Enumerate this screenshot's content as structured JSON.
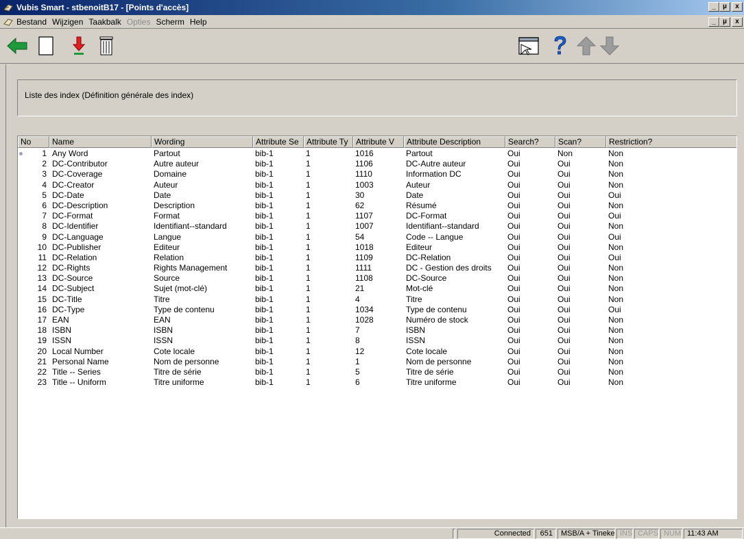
{
  "window": {
    "title": "Vubis Smart - stbenoitB17 - [Points d'accès]",
    "controls": [
      "_",
      "µ",
      "x"
    ]
  },
  "menu": [
    {
      "label": "Bestand",
      "disabled": false
    },
    {
      "label": "Wijzigen",
      "disabled": false
    },
    {
      "label": "Taakbalk",
      "disabled": false
    },
    {
      "label": "Opties",
      "disabled": true
    },
    {
      "label": "Scherm",
      "disabled": false
    },
    {
      "label": "Help",
      "disabled": false
    }
  ],
  "toolbar": {
    "icons": [
      "back-arrow-icon",
      "new-document-icon",
      "download-arrow-icon",
      "trash-icon",
      "window-select-icon",
      "help-question-icon",
      "arrow-up-icon",
      "arrow-down-icon"
    ],
    "colors": {
      "back": "#1e9a3a",
      "down": "#e02020",
      "gray_arrow": "#9c9c9c",
      "help": "#1a5dc8"
    }
  },
  "header": {
    "text": "Liste des index (Définition générale des index)"
  },
  "grid": {
    "columns": [
      "No",
      "Name",
      "Wording",
      "Attribute Se",
      "Attribute Ty",
      "Attribute V",
      "Attribute Description",
      "Search?",
      "Scan?",
      "Restriction?"
    ],
    "rows": [
      [
        "1",
        "Any Word",
        "Partout",
        "bib-1",
        "1",
        "1016",
        "Partout",
        "Oui",
        "Non",
        "Non"
      ],
      [
        "2",
        "DC-Contributor",
        "Autre auteur",
        "bib-1",
        "1",
        "1106",
        "DC-Autre auteur",
        "Oui",
        "Oui",
        "Non"
      ],
      [
        "3",
        "DC-Coverage",
        "Domaine",
        "bib-1",
        "1",
        "1110",
        "Information DC",
        "Oui",
        "Oui",
        "Non"
      ],
      [
        "4",
        "DC-Creator",
        "Auteur",
        "bib-1",
        "1",
        "1003",
        "Auteur",
        "Oui",
        "Oui",
        "Non"
      ],
      [
        "5",
        "DC-Date",
        "Date",
        "bib-1",
        "1",
        "30",
        "Date",
        "Oui",
        "Oui",
        "Oui"
      ],
      [
        "6",
        "DC-Description",
        "Description",
        "bib-1",
        "1",
        "62",
        "Résumé",
        "Oui",
        "Oui",
        "Non"
      ],
      [
        "7",
        "DC-Format",
        "Format",
        "bib-1",
        "1",
        "1107",
        "DC-Format",
        "Oui",
        "Oui",
        "Oui"
      ],
      [
        "8",
        "DC-Identifier",
        "Identifiant--standard",
        "bib-1",
        "1",
        "1007",
        "Identifiant--standard",
        "Oui",
        "Oui",
        "Non"
      ],
      [
        "9",
        "DC-Language",
        "Langue",
        "bib-1",
        "1",
        "54",
        "Code -- Langue",
        "Oui",
        "Oui",
        "Oui"
      ],
      [
        "10",
        "DC-Publisher",
        "Editeur",
        "bib-1",
        "1",
        "1018",
        "Editeur",
        "Oui",
        "Oui",
        "Non"
      ],
      [
        "11",
        "DC-Relation",
        "Relation",
        "bib-1",
        "1",
        "1109",
        "DC-Relation",
        "Oui",
        "Oui",
        "Oui"
      ],
      [
        "12",
        "DC-Rights",
        "Rights Management",
        "bib-1",
        "1",
        "1111",
        "DC - Gestion des droits",
        "Oui",
        "Oui",
        "Non"
      ],
      [
        "13",
        "DC-Source",
        "Source",
        "bib-1",
        "1",
        "1108",
        "DC-Source",
        "Oui",
        "Oui",
        "Non"
      ],
      [
        "14",
        "DC-Subject",
        "Sujet (mot-clé)",
        "bib-1",
        "1",
        "21",
        "Mot-clé",
        "Oui",
        "Oui",
        "Non"
      ],
      [
        "15",
        "DC-Title",
        "Titre",
        "bib-1",
        "1",
        "4",
        "Titre",
        "Oui",
        "Oui",
        "Non"
      ],
      [
        "16",
        "DC-Type",
        "Type de contenu",
        "bib-1",
        "1",
        "1034",
        "Type de contenu",
        "Oui",
        "Oui",
        "Oui"
      ],
      [
        "17",
        "EAN",
        "EAN",
        "bib-1",
        "1",
        "1028",
        "Numéro de stock",
        "Oui",
        "Oui",
        "Non"
      ],
      [
        "18",
        "ISBN",
        "ISBN",
        "bib-1",
        "1",
        "7",
        "ISBN",
        "Oui",
        "Oui",
        "Non"
      ],
      [
        "19",
        "ISSN",
        "ISSN",
        "bib-1",
        "1",
        "8",
        "ISSN",
        "Oui",
        "Oui",
        "Non"
      ],
      [
        "20",
        "Local Number",
        "Cote locale",
        "bib-1",
        "1",
        "12",
        "Cote locale",
        "Oui",
        "Oui",
        "Non"
      ],
      [
        "21",
        "Personal Name",
        "Nom de personne",
        "bib-1",
        "1",
        "1",
        "Nom de personne",
        "Oui",
        "Oui",
        "Non"
      ],
      [
        "22",
        "Title -- Series",
        "Titre de série",
        "bib-1",
        "1",
        "5",
        "Titre de série",
        "Oui",
        "Oui",
        "Non"
      ],
      [
        "23",
        "Title -- Uniform",
        "Titre uniforme",
        "bib-1",
        "1",
        "6",
        "Titre uniforme",
        "Oui",
        "Oui",
        "Non"
      ]
    ]
  },
  "status": {
    "connection": "Connected",
    "count": "651",
    "user": "MSB/A + Tineke",
    "ins": "INS",
    "caps": "CAPS",
    "num": "NUM",
    "time": "11:43 AM"
  }
}
